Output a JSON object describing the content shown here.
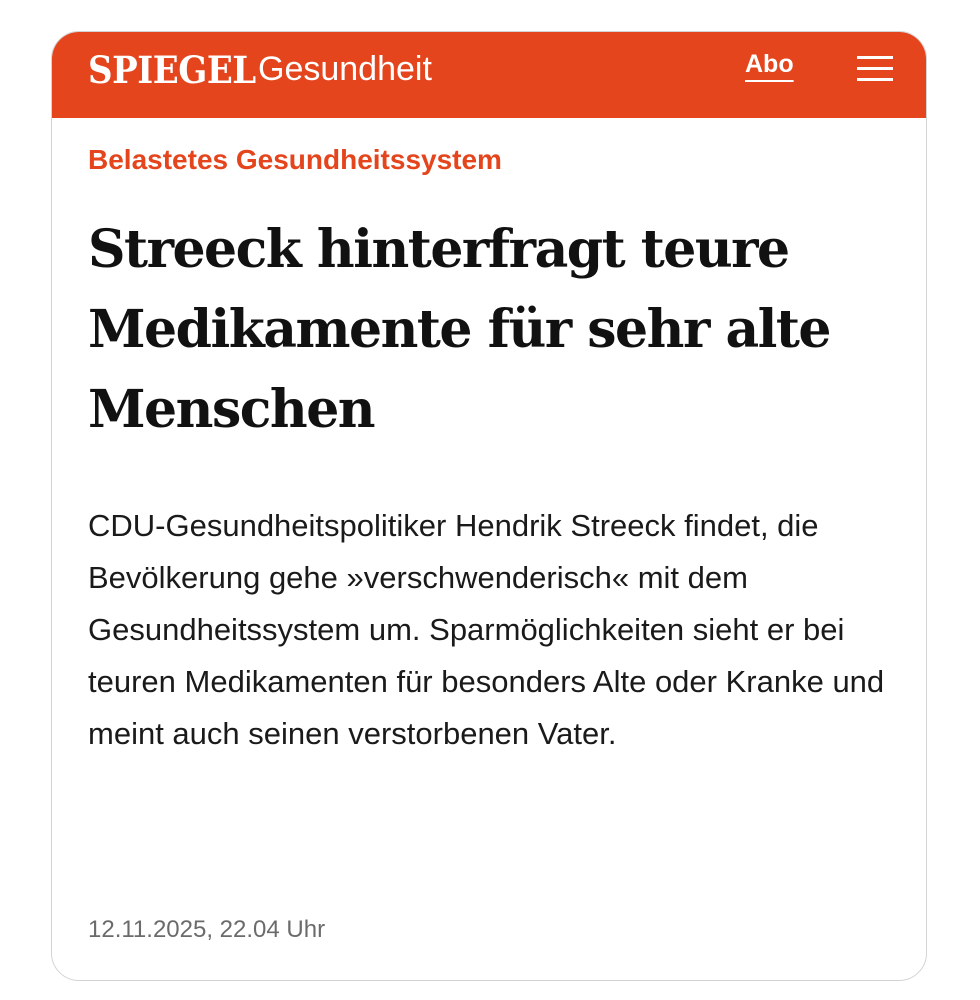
{
  "header": {
    "brand": "SPIEGEL",
    "section": "Gesundheit",
    "abo_label": "Abo",
    "menu_icon": "hamburger-menu-icon",
    "background_color": "#e4451d"
  },
  "article": {
    "kicker": "Belastetes Gesundheitssystem",
    "headline": "Streeck hinterfragt teure Medikamente für sehr alte Menschen",
    "teaser": "CDU-Gesundheitspolitiker Hendrik Streeck findet, die Bevölkerung gehe »verschwenderisch« mit dem Gesundheitssystem um. Sparmöglichkeiten sieht er bei teuren Medikamenten für besonders Alte oder Kranke und meint auch seinen verstorbenen Vater.",
    "timestamp": "12.11.2025, 22.04 Uhr",
    "kicker_color": "#e4451d"
  }
}
